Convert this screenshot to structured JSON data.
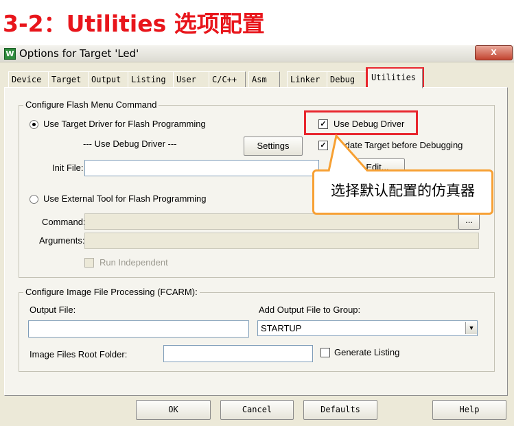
{
  "heading": "3-2：Utilities 选项配置",
  "window": {
    "title": "Options for Target 'Led'",
    "close_glyph": "x",
    "app_icon_glyph": "W"
  },
  "tabs": [
    {
      "label": "Device"
    },
    {
      "label": "Target"
    },
    {
      "label": "Output"
    },
    {
      "label": "Listing"
    },
    {
      "label": "User"
    },
    {
      "label": "C/C++"
    },
    {
      "label": "Asm"
    },
    {
      "label": "Linker"
    },
    {
      "label": "Debug"
    },
    {
      "label": "Utilities",
      "active": true
    }
  ],
  "flash_group": {
    "legend": "Configure Flash Menu Command",
    "radio_target": "Use Target Driver for Flash Programming",
    "use_debug_driver_check": "Use Debug Driver",
    "driver_label": "--- Use Debug Driver ---",
    "settings_button": "Settings",
    "update_target_check": "Update Target before Debugging",
    "init_file_label": "Init File:",
    "init_file_value": "",
    "edit_button": "Edit...",
    "radio_external": "Use External Tool for Flash Programming",
    "command_label": "Command:",
    "arguments_label": "Arguments:",
    "browse_button": "...",
    "run_independent": "Run Independent"
  },
  "callout": {
    "text": "选择默认配置的仿真器"
  },
  "image_group": {
    "legend": "Configure Image File Processing (FCARM):",
    "output_file_label": "Output File:",
    "output_file_value": "",
    "add_output_label": "Add Output File  to Group:",
    "group_selected": "STARTUP",
    "root_folder_label": "Image Files Root Folder:",
    "root_folder_value": "",
    "generate_listing": "Generate Listing"
  },
  "buttons": {
    "ok": "OK",
    "cancel": "Cancel",
    "defaults": "Defaults",
    "help": "Help"
  },
  "colors": {
    "heading": "#e8151b",
    "highlight_box": "#e8262d",
    "callout_border": "#f7a033"
  }
}
